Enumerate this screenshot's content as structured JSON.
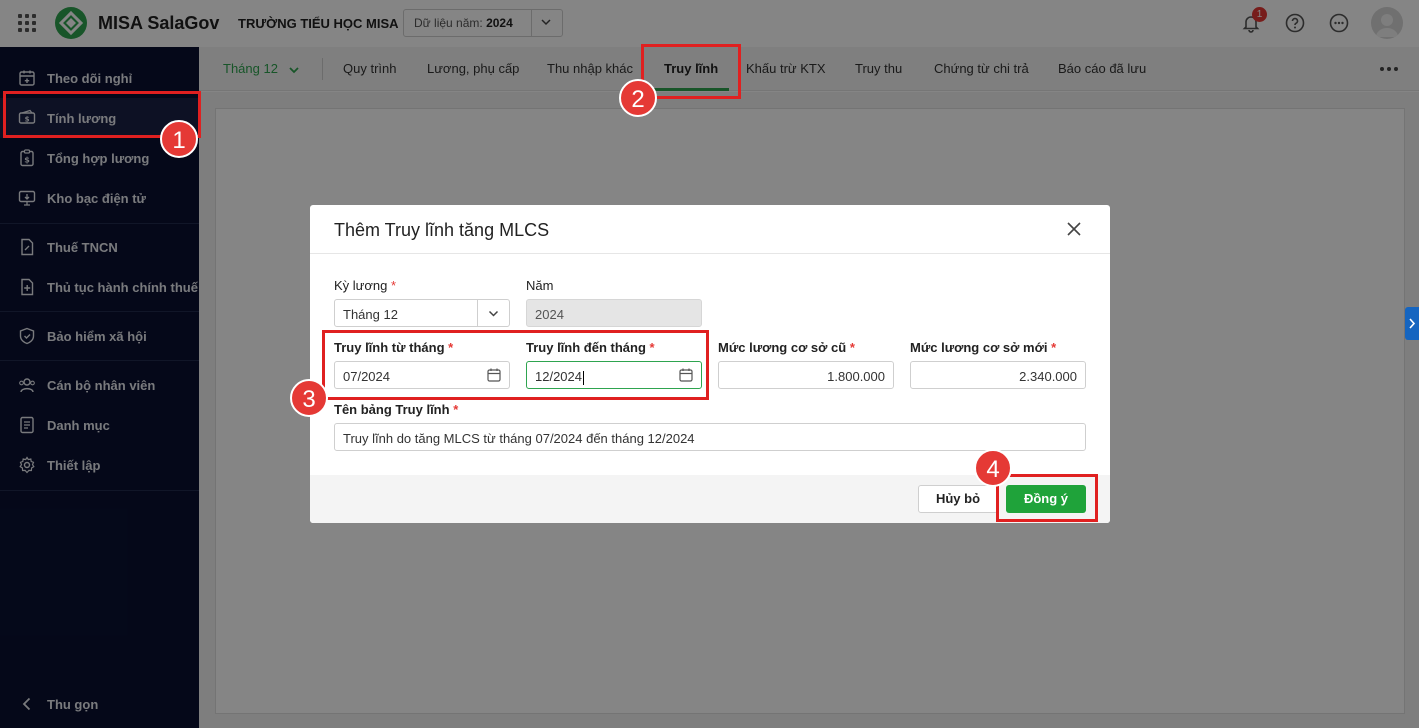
{
  "header": {
    "brand": "MISA SalaGov",
    "school": "TRƯỜNG TIỂU HỌC MISA",
    "year_label": "Dữ liệu năm:",
    "year_value": "2024",
    "notification_count": "1"
  },
  "sidebar": {
    "items": [
      {
        "label": "Theo dõi nghỉ",
        "icon": "calendar-plus-icon"
      },
      {
        "label": "Tính lương",
        "icon": "money-icon"
      },
      {
        "label": "Tổng hợp lương",
        "icon": "clipboard-dollar-icon"
      },
      {
        "label": "Kho bạc điện tử",
        "icon": "monitor-icon"
      },
      {
        "label": "Thuế TNCN",
        "icon": "tax-doc-icon"
      },
      {
        "label": "Thủ tục hành chính thuế",
        "icon": "doc-plus-icon"
      },
      {
        "label": "Bảo hiểm xã hội",
        "icon": "shield-icon"
      },
      {
        "label": "Cán bộ nhân viên",
        "icon": "users-icon"
      },
      {
        "label": "Danh mục",
        "icon": "list-doc-icon"
      },
      {
        "label": "Thiết lập",
        "icon": "gear-icon"
      }
    ],
    "collapse_label": "Thu gọn"
  },
  "tabs": {
    "month": "Tháng 12",
    "items": [
      "Quy trình",
      "Lương, phụ cấp",
      "Thu nhập khác",
      "Truy lĩnh",
      "Khấu trừ KTX",
      "Truy thu",
      "Chứng từ chi trả",
      "Báo cáo đã lưu"
    ],
    "active": "Truy lĩnh"
  },
  "dialog": {
    "title": "Thêm Truy lĩnh tăng MLCS",
    "ky_luong_label": "Kỳ lương",
    "ky_luong_value": "Tháng 12",
    "nam_label": "Năm",
    "nam_value": "2024",
    "tu_thang_label": "Truy lĩnh từ tháng",
    "tu_thang_value": "07/2024",
    "den_thang_label": "Truy lĩnh đến tháng",
    "den_thang_value": "12/2024",
    "muc_cu_label": "Mức lương cơ sở cũ",
    "muc_cu_value": "1.800.000",
    "muc_moi_label": "Mức lương cơ sở mới",
    "muc_moi_value": "2.340.000",
    "ten_bang_label": "Tên bảng Truy lĩnh",
    "ten_bang_value": "Truy lĩnh do tăng MLCS từ tháng 07/2024 đến tháng 12/2024",
    "required_mark": "*",
    "cancel_label": "Hủy bỏ",
    "ok_label": "Đồng ý"
  },
  "annotations": {
    "markers": [
      "1",
      "2",
      "3",
      "4"
    ],
    "color": "#e02020"
  },
  "colors": {
    "brand_green": "#2ea44f",
    "sidebar_bg": "#0a1131",
    "ok_button": "#1fa33a"
  }
}
